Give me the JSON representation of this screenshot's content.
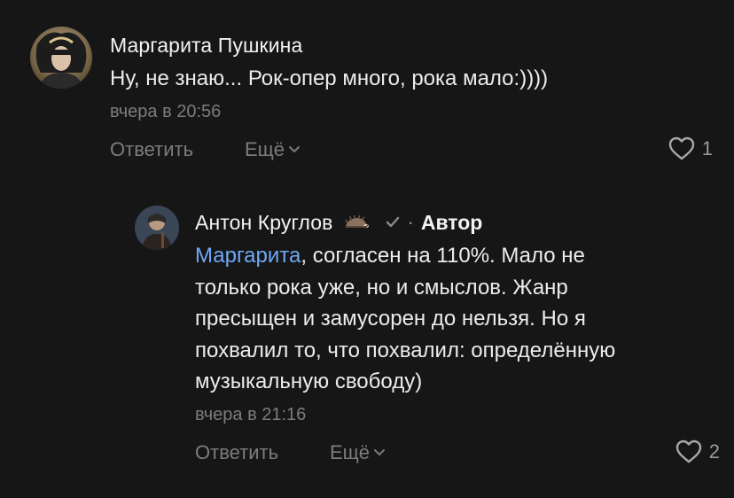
{
  "comments": [
    {
      "author": "Маргарита Пушкина",
      "text": "Ну, не знаю... Рок-опер много, рока мало:))))",
      "time": "вчера в 20:56",
      "reply_label": "Ответить",
      "more_label": "Ещё",
      "likes": "1"
    },
    {
      "author": "Антон Круглов",
      "author_badge": "Автор",
      "separator": "·",
      "mention": "Маргарита",
      "text_lines": [
        ", согласен на 110%. Мало не",
        "только рока уже, но и смыслов. Жанр",
        "пресыщен и замусорен до нельзя. Но я",
        "похвалил то, что похвалил: определённую",
        "музыкальную свободу)"
      ],
      "time": "вчера в 21:16",
      "reply_label": "Ответить",
      "more_label": "Ещё",
      "likes": "2"
    }
  ],
  "colors": {
    "background": "#161616",
    "mention": "#6ea8f5",
    "muted": "#7c7c7c"
  },
  "icons": [
    "user-avatar",
    "hedgehog-icon",
    "verified-check-icon",
    "chevron-down-icon",
    "heart-icon"
  ]
}
